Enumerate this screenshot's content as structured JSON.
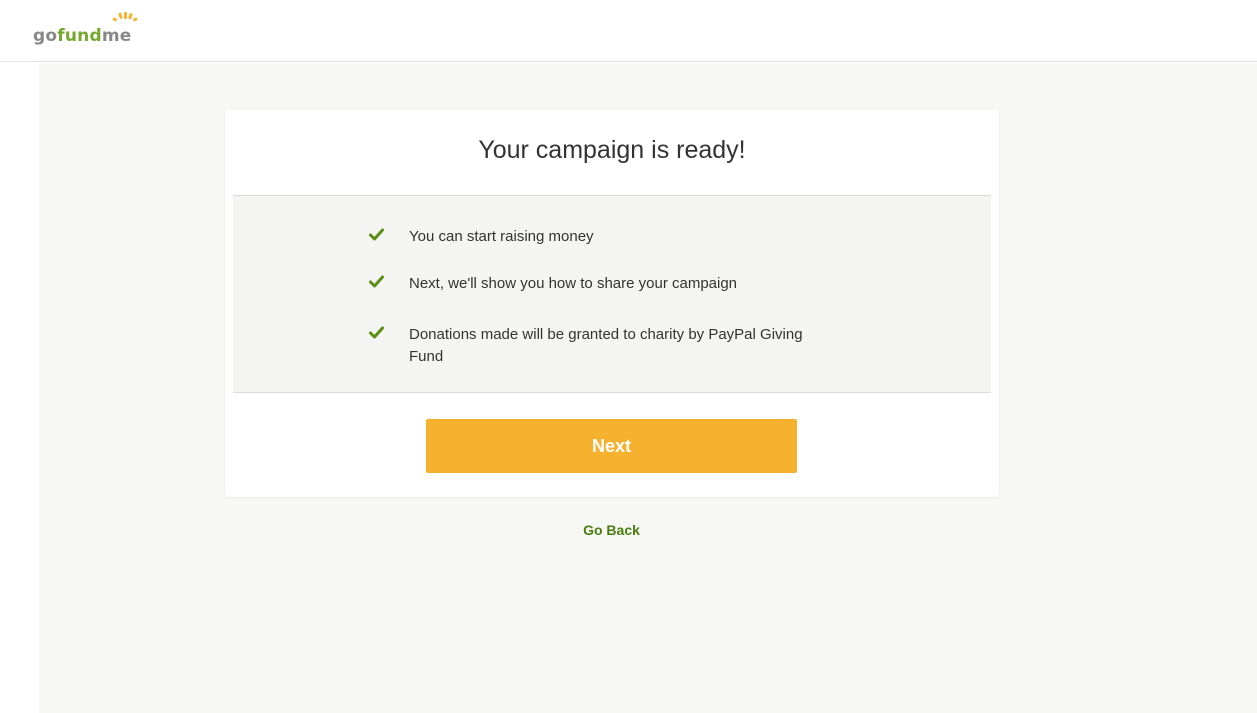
{
  "brand": {
    "logo_text": "gofundme",
    "logo_go": "go",
    "logo_fund": "fund",
    "logo_me": "me",
    "primary_color": "#74a92d",
    "accent_color": "#f6b22f"
  },
  "card": {
    "title": "Your campaign is ready!",
    "features": [
      {
        "icon": "check-icon",
        "text": "You can start raising money"
      },
      {
        "icon": "check-icon",
        "text": "Next, we'll show you how to share your campaign"
      },
      {
        "icon": "check-icon",
        "text": "Donations made will be granted to charity by PayPal Giving Fund"
      }
    ],
    "next_label": "Next"
  },
  "footer": {
    "go_back_label": "Go Back"
  }
}
